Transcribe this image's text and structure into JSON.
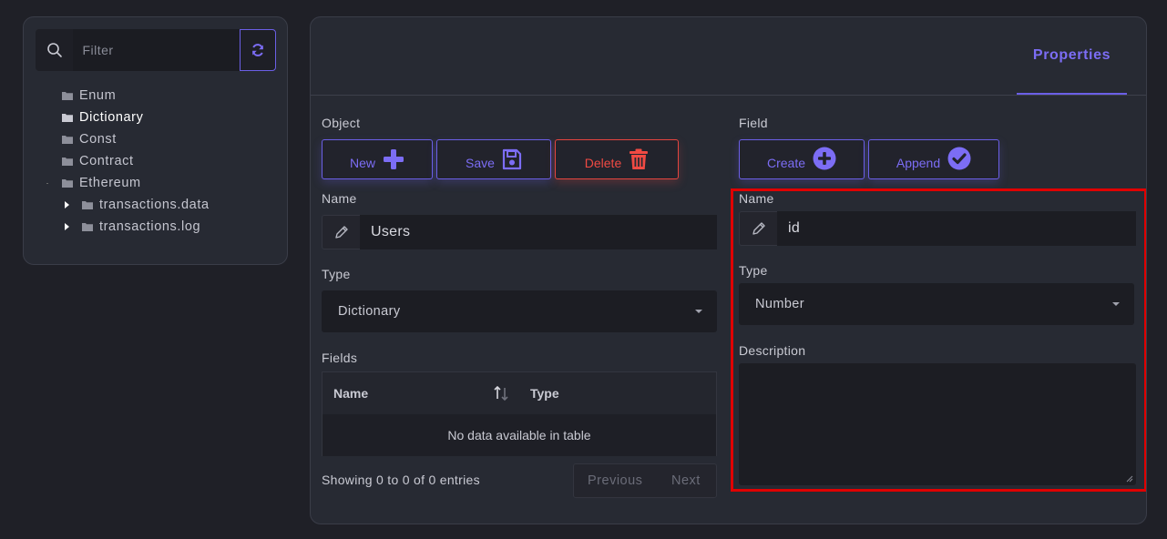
{
  "sidebar": {
    "filter_placeholder": "Filter",
    "tree": [
      {
        "label": "Enum",
        "selected": false
      },
      {
        "label": "Dictionary",
        "selected": true
      },
      {
        "label": "Const",
        "selected": false
      },
      {
        "label": "Contract",
        "selected": false
      },
      {
        "label": "Ethereum",
        "selected": false
      },
      {
        "label": "transactions.data",
        "selected": false
      },
      {
        "label": "transactions.log",
        "selected": false
      }
    ]
  },
  "tabs": {
    "properties": "Properties"
  },
  "object": {
    "section_label": "Object",
    "new_label": "New",
    "save_label": "Save",
    "delete_label": "Delete",
    "name_label": "Name",
    "name_value": "Users",
    "type_label": "Type",
    "type_value": "Dictionary",
    "fields_label": "Fields",
    "table": {
      "columns": [
        "Name",
        "Type"
      ],
      "empty_text": "No data available in table"
    },
    "info_text": "Showing 0 to 0 of 0 entries",
    "previous_label": "Previous",
    "next_label": "Next"
  },
  "field": {
    "section_label": "Field",
    "create_label": "Create",
    "append_label": "Append",
    "name_label": "Name",
    "name_value": "id",
    "type_label": "Type",
    "type_value": "Number",
    "description_label": "Description",
    "description_value": ""
  },
  "colors": {
    "accent": "#6b5fe6",
    "danger": "#e5453f",
    "highlight": "#e00000"
  }
}
